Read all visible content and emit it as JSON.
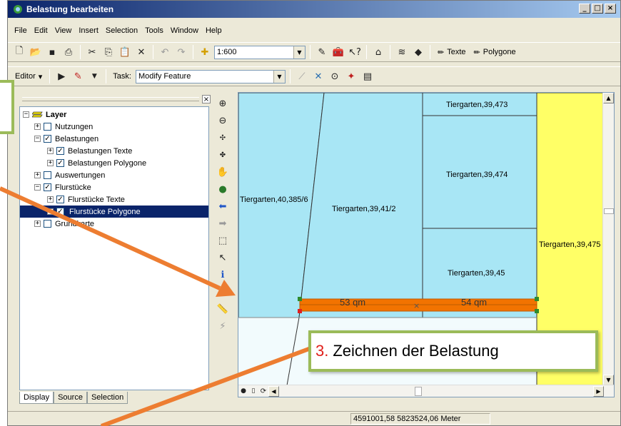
{
  "window": {
    "title": "Belastung bearbeiten"
  },
  "menu": [
    "File",
    "Edit",
    "View",
    "Insert",
    "Selection",
    "Tools",
    "Window",
    "Help"
  ],
  "toolbar1": {
    "scale": "1:600",
    "texte_label": "Texte",
    "polygone_label": "Polygone"
  },
  "toolbar2": {
    "editor_label": "Editor",
    "task_label": "Task:",
    "task_value": "Modify Feature"
  },
  "toc": {
    "root": "Layer",
    "items": [
      {
        "label": "Nutzungen",
        "checked": false,
        "level": 1,
        "expander": "+"
      },
      {
        "label": "Belastungen",
        "checked": true,
        "level": 1,
        "expander": "−"
      },
      {
        "label": "Belastungen Texte",
        "checked": true,
        "level": 2,
        "expander": "+"
      },
      {
        "label": "Belastungen Polygone",
        "checked": true,
        "level": 2,
        "expander": "+"
      },
      {
        "label": "Auswertungen",
        "checked": false,
        "level": 1,
        "expander": "+"
      },
      {
        "label": "Flurstücke",
        "checked": true,
        "level": 1,
        "expander": "−"
      },
      {
        "label": "Flurstücke Texte",
        "checked": true,
        "level": 2,
        "expander": "+"
      },
      {
        "label": "Flurstücke Polygone",
        "checked": true,
        "level": 2,
        "expander": "+",
        "selected": true
      },
      {
        "label": "Grundkarte",
        "checked": false,
        "level": 1,
        "expander": "+"
      }
    ],
    "tabs": [
      "Display",
      "Source",
      "Selection"
    ]
  },
  "map": {
    "parcel_labels": [
      "Tiergarten,39,473",
      "Tiergarten,39,474",
      "Tiergarten,40,385/6",
      "Tiergarten,39,41/2",
      "Tiergarten,39,475",
      "Tiergarten,39,45"
    ],
    "area_labels": [
      "53 qm",
      "54 qm"
    ],
    "colors": {
      "parcel_blue": "#A8E6F5",
      "parcel_yellow": "#FFFF66",
      "burden_orange": "#F27300",
      "vertex_green": "#2E8B2E",
      "vertex_red": "#E02020"
    }
  },
  "status": {
    "coordinates": "4591001,58  5823524,06 Meter"
  },
  "callout": {
    "number": "3.",
    "text": "Zeichnen der Belastung"
  },
  "accent": {
    "arrow_orange": "#ED7D31",
    "callout_border": "#9BBB59"
  }
}
